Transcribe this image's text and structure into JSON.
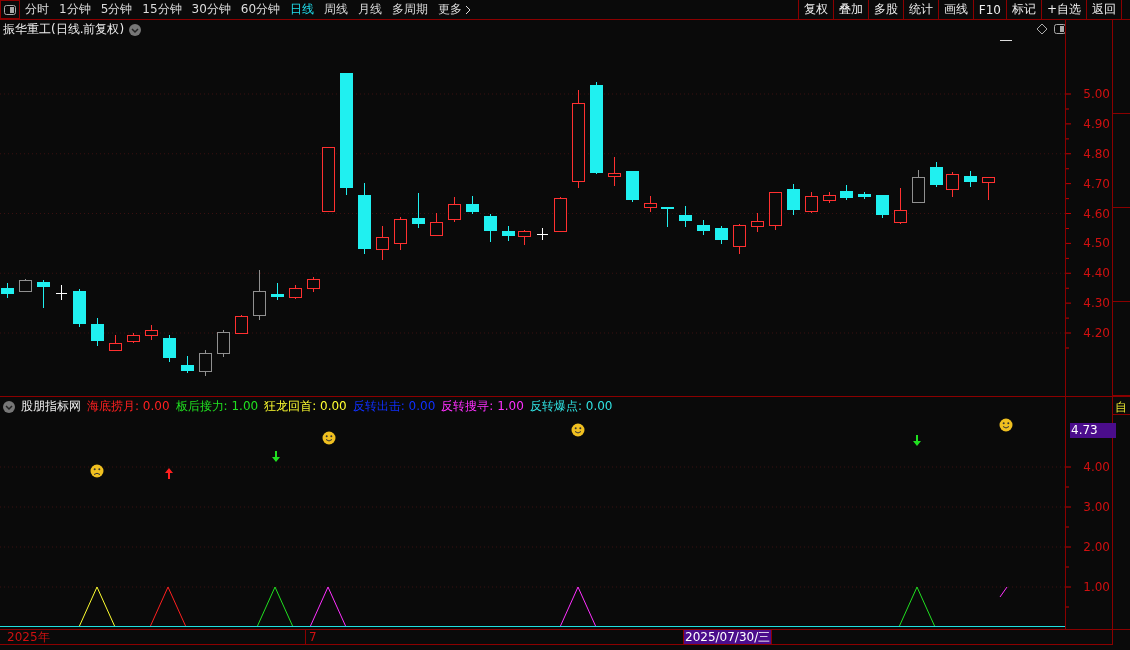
{
  "toolbar": {
    "periods": [
      {
        "label": "分时",
        "selected": false
      },
      {
        "label": "1分钟",
        "selected": false
      },
      {
        "label": "5分钟",
        "selected": false
      },
      {
        "label": "15分钟",
        "selected": false
      },
      {
        "label": "30分钟",
        "selected": false
      },
      {
        "label": "60分钟",
        "selected": false
      },
      {
        "label": "日线",
        "selected": true
      },
      {
        "label": "周线",
        "selected": false
      },
      {
        "label": "月线",
        "selected": false
      },
      {
        "label": "多周期",
        "selected": false
      }
    ],
    "more": "更多",
    "actions": [
      "复权",
      "叠加",
      "多股",
      "统计",
      "画线",
      "F10",
      "标记",
      "+自选",
      "返回"
    ]
  },
  "chart": {
    "title": "振华重工(日线.前复权)",
    "price_ticks": [
      "5.00",
      "4.90",
      "4.80",
      "4.70",
      "4.60",
      "4.50",
      "4.40",
      "4.30",
      "4.20"
    ]
  },
  "indicator": {
    "name": "股朋指标网",
    "values": [
      {
        "text": "海底捞月: 0.00",
        "color": "#ff2020"
      },
      {
        "text": "板后接力: 1.00",
        "color": "#20e020"
      },
      {
        "text": "狂龙回首: 0.00",
        "color": "#ffff30"
      },
      {
        "text": "反转出击: 0.00",
        "color": "#1030ff"
      },
      {
        "text": "反转搜寻: 1.00",
        "color": "#ff30ff"
      },
      {
        "text": "反转爆点: 0.00",
        "color": "#30e0e0"
      }
    ],
    "current_value": "4.73",
    "ticks": [
      "4.00",
      "3.00",
      "2.00",
      "1.00"
    ]
  },
  "side_tab": "自",
  "date_bar": {
    "year": "2025年",
    "month": "7",
    "cursor_date": "2025/07/30/三"
  }
}
